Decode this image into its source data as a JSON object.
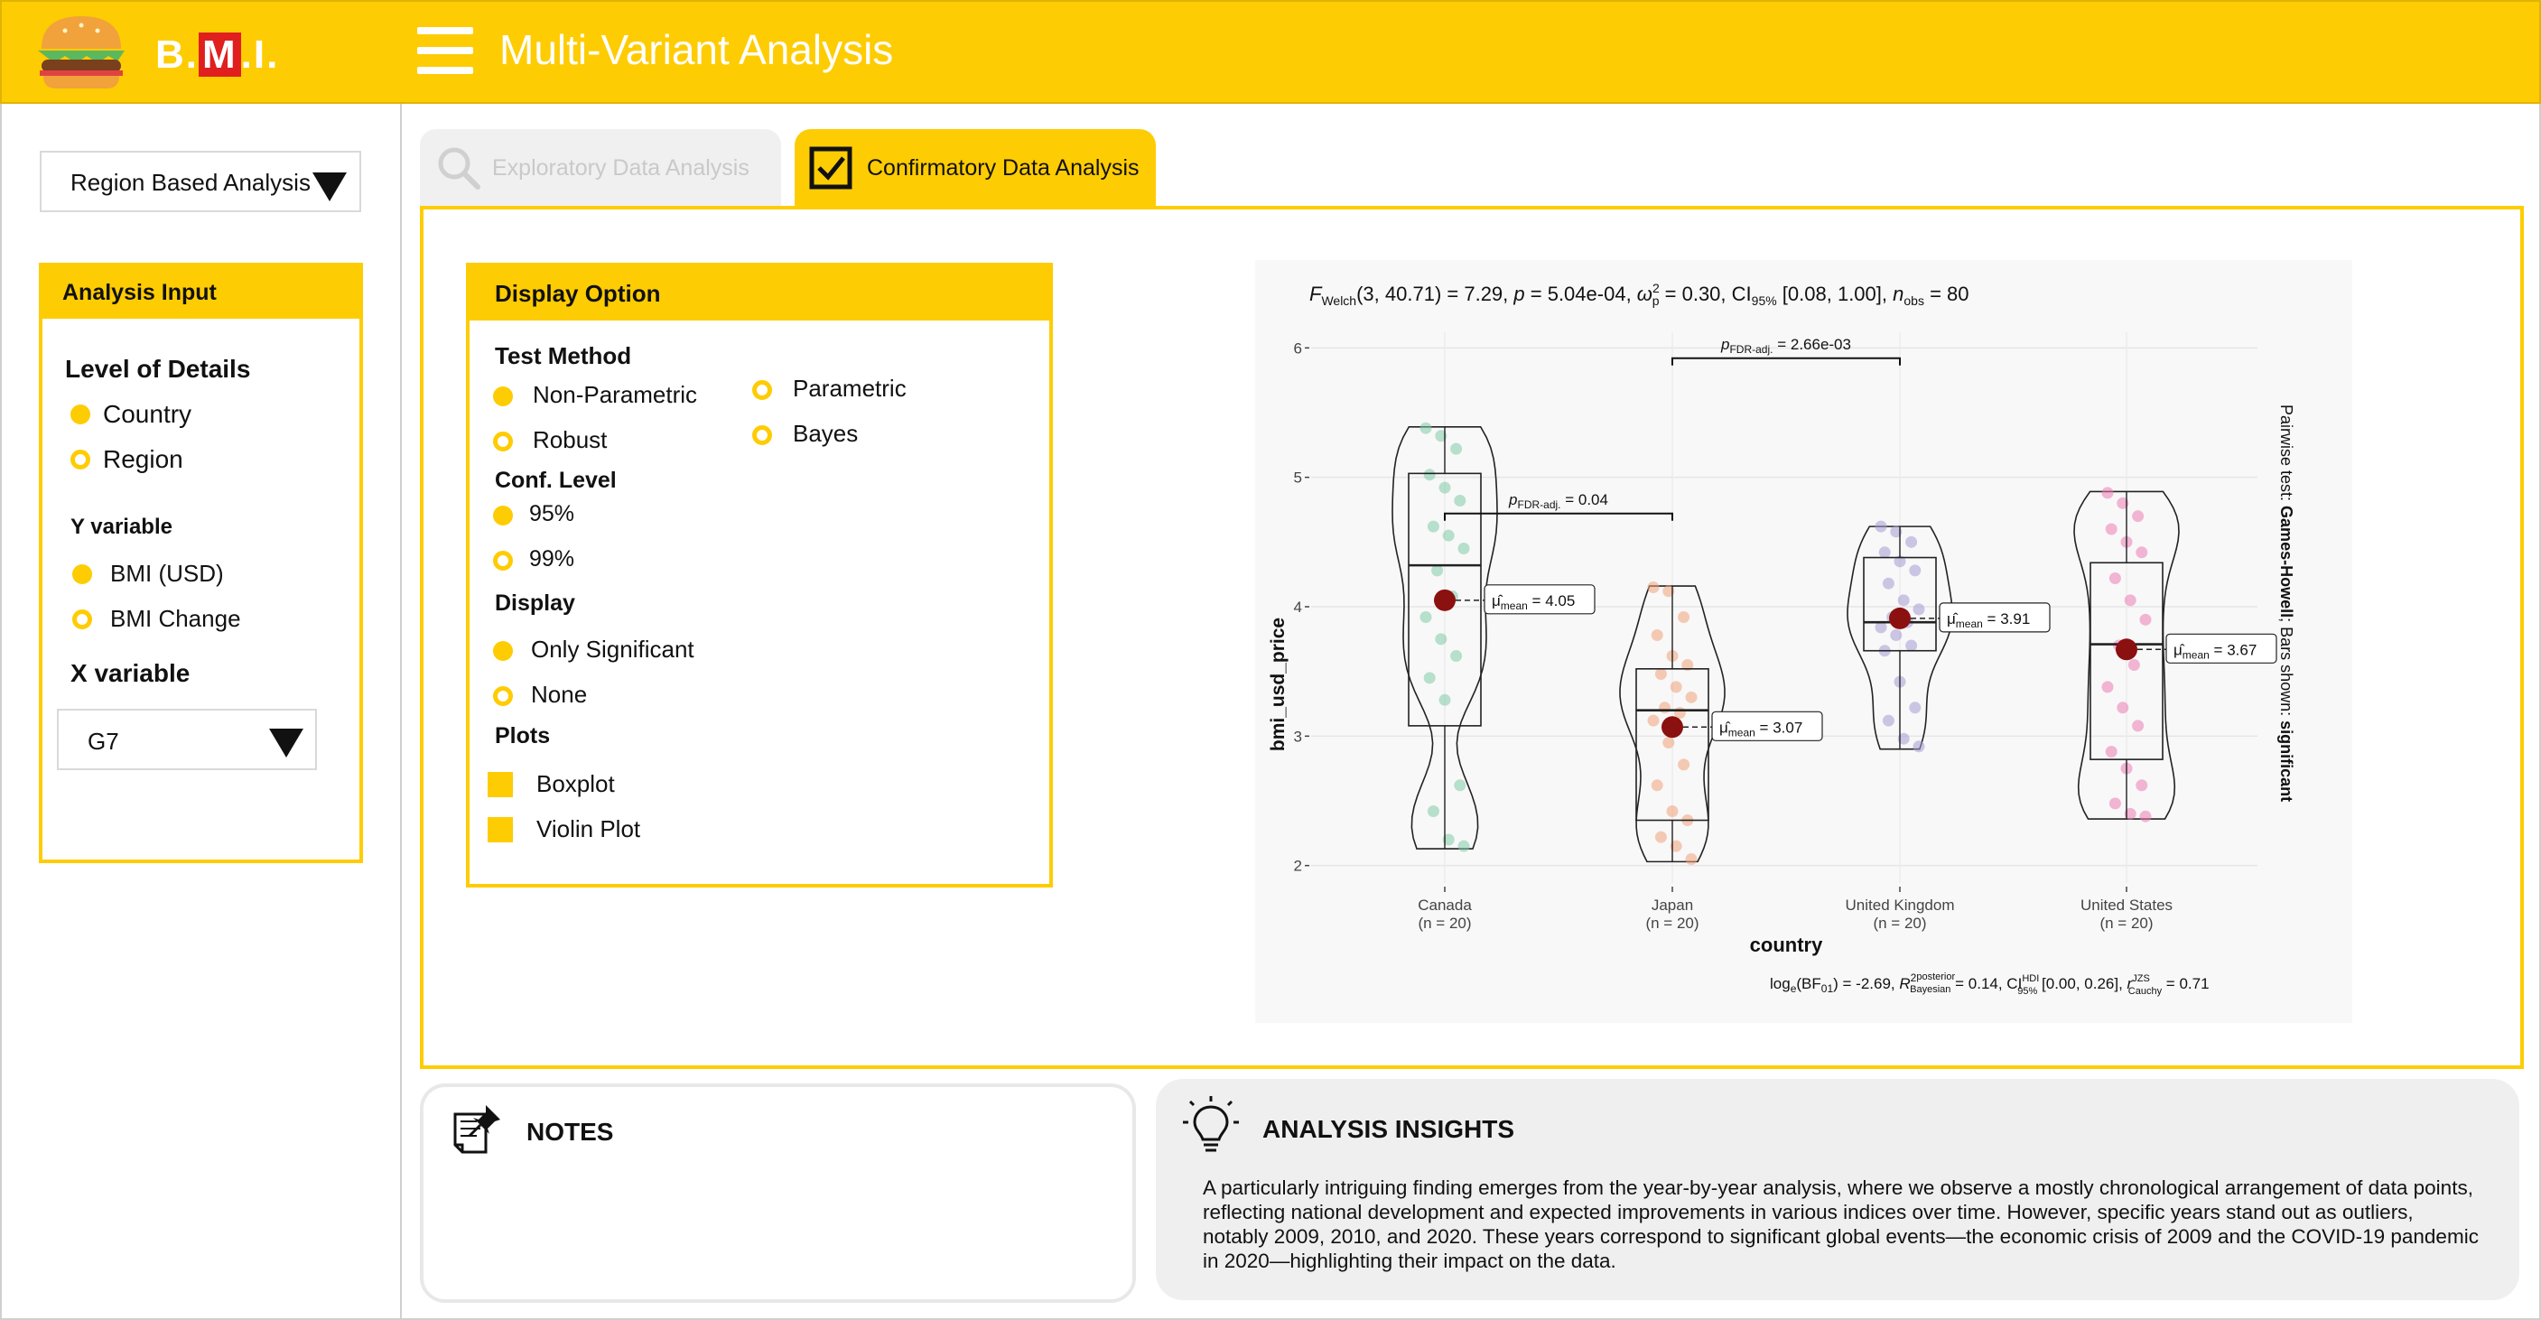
{
  "app": {
    "logo_text_1": "B.",
    "logo_text_m": "M",
    "logo_text_2": ".I.",
    "title": "Multi-Variant Analysis"
  },
  "sidebar": {
    "analysis_select": "Region Based Analysis",
    "analysis_input_title": "Analysis Input",
    "level_label": "Level of Details",
    "level_options": [
      "Country",
      "Region"
    ],
    "level_selected": "Country",
    "y_label": "Y variable",
    "y_options": [
      "BMI (USD)",
      "BMI Change"
    ],
    "y_selected": "BMI (USD)",
    "x_label": "X variable",
    "x_select": "G7"
  },
  "tabs": [
    {
      "label": "Exploratory Data Analysis",
      "active": false
    },
    {
      "label": "Confirmatory Data Analysis",
      "active": true
    }
  ],
  "display_option": {
    "title": "Display Option",
    "test_method_label": "Test Method",
    "test_methods": [
      "Non-Parametric",
      "Robust",
      "Parametric",
      "Bayes"
    ],
    "test_method_selected": "Non-Parametric",
    "conf_level_label": "Conf. Level",
    "conf_levels": [
      "95%",
      "99%"
    ],
    "conf_selected": "95%",
    "display_label": "Display",
    "display_options": [
      "Only Significant",
      "None"
    ],
    "display_selected": "Only Significant",
    "plots_label": "Plots",
    "plots": [
      "Boxplot",
      "Violin Plot"
    ]
  },
  "chart_data": {
    "type": "violin-box",
    "title": "F_Welch(3, 40.71) = 7.29, p = 5.04e-04, ω̂²p = 0.30, CI95% [0.08, 1.00], n_obs = 80",
    "title_parts": {
      "f": "F",
      "f_sub": "Welch",
      "stat": "(3, 40.71) = 7.29, ",
      "p": "p",
      "p_val": " = 5.04e-04, ",
      "omega": "ω",
      "omega_sup": "2",
      "omega_sub": "p",
      "omega_val": " = 0.30, CI",
      "ci_sub": "95%",
      "ci_val": " [0.08, 1.00], ",
      "n": "n",
      "n_sub": "obs",
      "n_val": " = 80"
    },
    "subtitle": "log_e(BF01) = -2.69, R̂²posterior Bayesian = 0.14, CI HDI 95% [0.00, 0.26], r JZS Cauchy = 0.71",
    "caption_parts": {
      "a": "log",
      "a_sub": "e",
      "b": "(BF",
      "b_sub": "01",
      "c": ") = -2.69, ",
      "r": "R",
      "r_sup": "2",
      "r_sup2": "posterior",
      "r_sub": "Bayesian",
      "r_val": " = 0.14, CI",
      "ci_sup": "HDI",
      "ci_sub": "95%",
      "ci_val": " [0.00, 0.26], ",
      "rc": "r",
      "rc_sup": "JZS",
      "rc_sub": "Cauchy",
      "rc_val": " = 0.71"
    },
    "xlabel": "country",
    "ylabel": "bmi_usd_price",
    "ylim": [
      1.9,
      6.1
    ],
    "yticks": [
      2,
      3,
      4,
      5,
      6
    ],
    "right_label_parts": {
      "a": "Pairwise test: ",
      "b": "Games-Howell",
      "c": "; Bars shown: ",
      "d": "significant"
    },
    "categories": [
      {
        "name": "Canada",
        "n": "(n = 20)",
        "mean": 4.05,
        "mean_label": "= 4.05",
        "q1": 3.08,
        "median": 4.32,
        "q3": 5.03,
        "min": 2.13,
        "max": 5.39,
        "color": "#7fcaa8",
        "points": [
          5.38,
          5.32,
          5.22,
          5.02,
          4.92,
          4.82,
          4.62,
          4.55,
          4.45,
          4.28,
          4.08,
          3.92,
          3.75,
          3.62,
          3.45,
          3.28,
          2.62,
          2.42,
          2.2,
          2.15
        ]
      },
      {
        "name": "Japan",
        "n": "(n = 20)",
        "mean": 3.07,
        "mean_label": "= 3.07",
        "q1": 2.35,
        "median": 3.2,
        "q3": 3.52,
        "min": 2.03,
        "max": 4.16,
        "color": "#f0a27a",
        "points": [
          4.15,
          4.12,
          3.92,
          3.78,
          3.62,
          3.55,
          3.48,
          3.38,
          3.3,
          3.22,
          3.18,
          3.12,
          2.95,
          2.78,
          2.62,
          2.42,
          2.35,
          2.22,
          2.15,
          2.05
        ]
      },
      {
        "name": "United Kingdom",
        "n": "(n = 20)",
        "mean": 3.91,
        "mean_label": "= 3.91",
        "q1": 3.66,
        "median": 3.88,
        "q3": 4.38,
        "min": 2.9,
        "max": 4.62,
        "color": "#a69ad4",
        "points": [
          4.62,
          4.58,
          4.5,
          4.42,
          4.35,
          4.28,
          4.18,
          4.05,
          3.98,
          3.92,
          3.88,
          3.84,
          3.78,
          3.7,
          3.66,
          3.42,
          3.22,
          3.12,
          2.98,
          2.92
        ]
      },
      {
        "name": "United States",
        "n": "(n = 20)",
        "mean": 3.67,
        "mean_label": "= 3.67",
        "q1": 2.82,
        "median": 3.71,
        "q3": 4.34,
        "min": 2.36,
        "max": 4.89,
        "color": "#ec7cb4",
        "points": [
          4.88,
          4.8,
          4.7,
          4.6,
          4.5,
          4.42,
          4.22,
          4.05,
          3.9,
          3.7,
          3.55,
          3.38,
          3.22,
          3.08,
          2.88,
          2.75,
          2.62,
          2.48,
          2.4,
          2.38
        ]
      }
    ],
    "comparisons": [
      {
        "from": 0,
        "to": 1,
        "y": 4.72,
        "label_p": "p",
        "label_sub": "FDR-adj.",
        "label_val": " = 0.04"
      },
      {
        "from": 1,
        "to": 2,
        "y": 5.92,
        "label_p": "p",
        "label_sub": "FDR-adj.",
        "label_val": " = 2.66e-03"
      }
    ],
    "mean_symbol": "μ̂",
    "mean_sub": "mean"
  },
  "notes": {
    "title": "NOTES"
  },
  "insights": {
    "title": "ANALYSIS INSIGHTS",
    "text": "A particularly intriguing finding emerges from the year-by-year analysis, where we observe a mostly chronological arrangement of data points, reflecting national development and expected improvements in various indices over time. However, specific years stand out as outliers, notably 2009, 2010, and 2020. These years correspond to significant global events—the economic crisis of 2009 and the COVID-19 pandemic in 2020—highlighting their impact on the data."
  },
  "colors": {
    "accent": "#FECC02",
    "mean_marker": "#8b1010"
  }
}
